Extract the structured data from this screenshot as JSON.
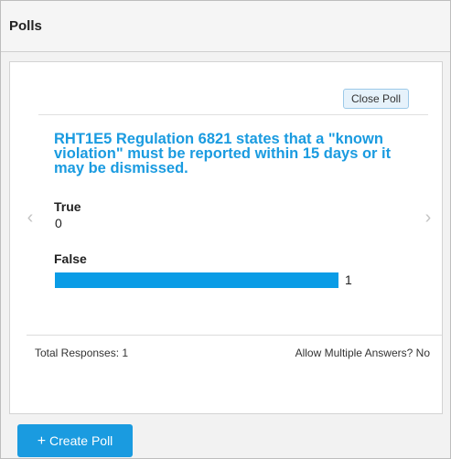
{
  "panel": {
    "title": "Polls"
  },
  "poll": {
    "close_label": "Close Poll",
    "question": "RHT1E5 Regulation 6821 states that a \"known violation\" must be reported within 15 days or it may be dismissed.",
    "options": [
      {
        "label": "True",
        "count": "0",
        "share": 0
      },
      {
        "label": "False",
        "count": "1",
        "share": 1
      }
    ],
    "total_responses": "Total Responses: 1",
    "allow_multiple": "Allow Multiple Answers? No"
  },
  "nav": {
    "prev_icon": "chevron-left-icon",
    "next_icon": "chevron-right-icon"
  },
  "actions": {
    "create_label": "Create Poll",
    "create_icon": "plus-icon"
  },
  "colors": {
    "accent": "#1a9be0",
    "bar": "#0a9ce6",
    "arrow": "#c4c4c4"
  }
}
